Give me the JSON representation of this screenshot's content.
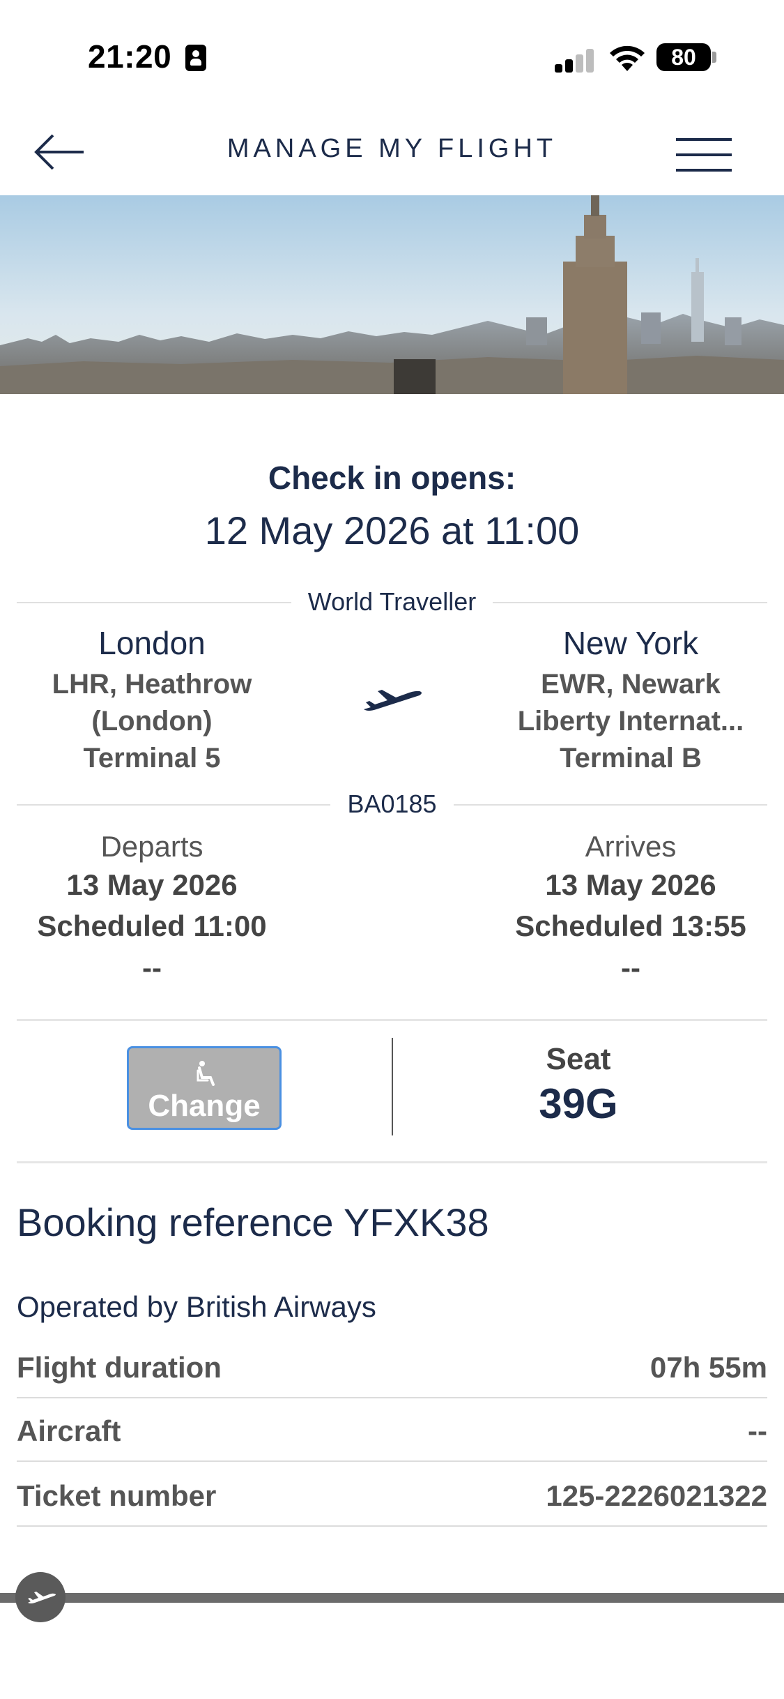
{
  "status_bar": {
    "time": "21:20",
    "battery": "80"
  },
  "header": {
    "title": "MANAGE MY FLIGHT",
    "back_icon": "arrow-left-icon",
    "menu_icon": "hamburger-menu-icon"
  },
  "checkin": {
    "label": "Check in opens:",
    "date": "12 May 2026 at 11:00"
  },
  "flight": {
    "cabin": "World Traveller",
    "number": "BA0185",
    "origin": {
      "city": "London",
      "airport_line1": "LHR, Heathrow",
      "airport_line2": "(London)",
      "terminal": "Terminal 5"
    },
    "destination": {
      "city": "New York",
      "airport_line1": "EWR, Newark",
      "airport_line2": "Liberty Internat...",
      "terminal": "Terminal B"
    },
    "departs": {
      "label": "Departs",
      "date": "13 May 2026",
      "scheduled": "Scheduled 11:00",
      "actual": "--"
    },
    "arrives": {
      "label": "Arrives",
      "date": "13 May 2026",
      "scheduled": "Scheduled 13:55",
      "actual": "--"
    }
  },
  "seat": {
    "change_label": "Change",
    "label": "Seat",
    "value": "39G"
  },
  "booking": {
    "reference": "Booking reference YFXK38",
    "operated_by": "Operated by British Airways",
    "details": [
      {
        "key": "Flight duration",
        "value": "07h 55m"
      },
      {
        "key": "Aircraft",
        "value": "--"
      },
      {
        "key": "Ticket number",
        "value": "125-2226021322"
      }
    ]
  },
  "colors": {
    "brand_navy": "#1c2b4a",
    "button_grey": "#b0b0b0",
    "button_border": "#4a90e2"
  }
}
